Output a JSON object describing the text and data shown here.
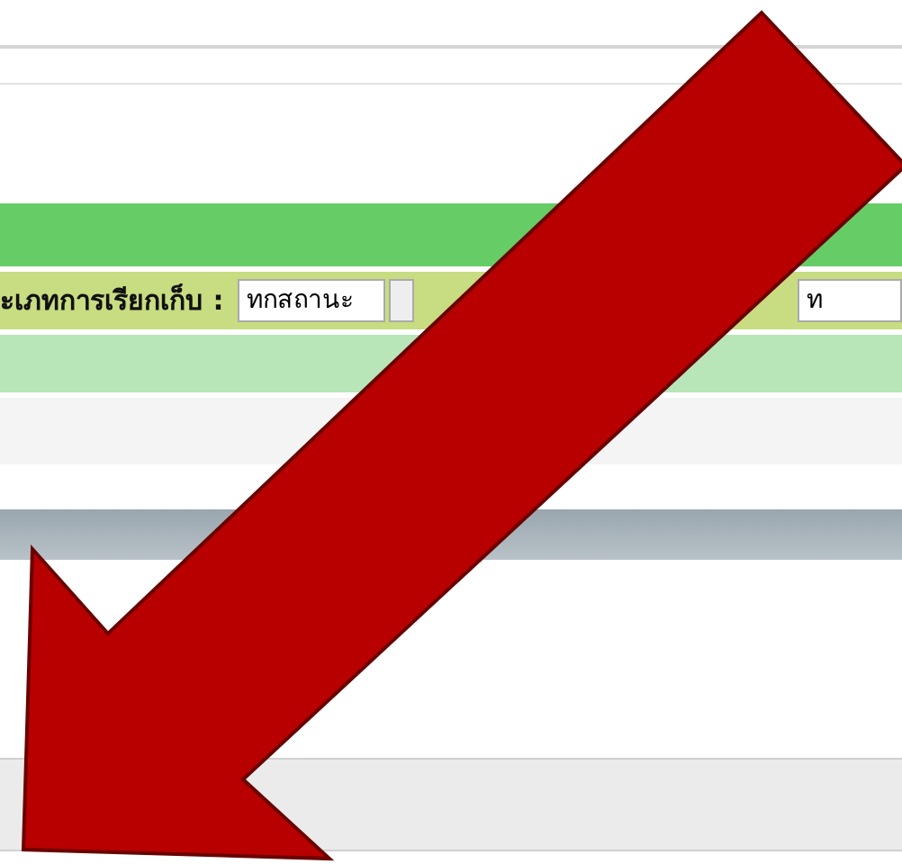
{
  "filter_bar": {
    "label": "ะเภทการเรียกเก็บ :",
    "status_select": {
      "value": "ทกสถานะ"
    },
    "field_2": {
      "value": "ท"
    }
  }
}
